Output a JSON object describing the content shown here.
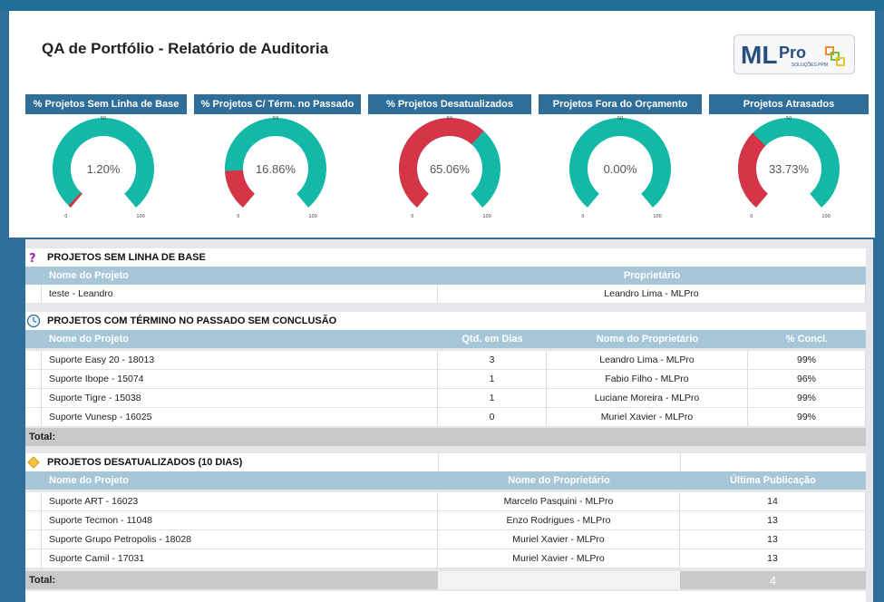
{
  "page": {
    "title": "QA de Portfólio - Relatório de Auditoria",
    "logo_text": "MLPro",
    "logo_sub": "SOLUÇÕES PPM"
  },
  "colors": {
    "teal": "#14b8a6",
    "red": "#d63447",
    "header_blue": "#2f6e99",
    "table_header": "#a7c6d8"
  },
  "cards": [
    {
      "title": "% Projetos Sem Linha de Base",
      "value_label": "1.20%",
      "value": 1.2
    },
    {
      "title": "% Projetos C/ Térm. no Passado",
      "value_label": "16.86%",
      "value": 16.86
    },
    {
      "title": "% Projetos Desatualizados",
      "value_label": "65.06%",
      "value": 65.06
    },
    {
      "title": "Projetos Fora do Orçamento",
      "value_label": "0.00%",
      "value": 0.0
    },
    {
      "title": "Projetos Atrasados",
      "value_label": "33.73%",
      "value": 33.73
    }
  ],
  "gauge_ticks": {
    "min": "0",
    "mid": "50",
    "max": "100"
  },
  "sections": {
    "baseline": {
      "icon": "question-icon",
      "title": "PROJETOS SEM LINHA DE BASE",
      "columns": [
        "Nome do Projeto",
        "Proprietário"
      ],
      "rows": [
        [
          "teste - Leandro",
          "Leandro Lima - MLPro"
        ]
      ]
    },
    "past": {
      "icon": "clock-icon",
      "title": "PROJETOS COM TÉRMINO NO PASSADO SEM CONCLUSÃO",
      "columns": [
        "Nome do Projeto",
        "Qtd. em Dias",
        "Nome do Proprietário",
        "% Concl."
      ],
      "rows": [
        [
          "Suporte Easy 20 - 18013",
          "3",
          "Leandro Lima - MLPro",
          "99%"
        ],
        [
          "Suporte Ibope - 15074",
          "1",
          "Fabio Filho - MLPro",
          "96%"
        ],
        [
          "Suporte Tigre - 15038",
          "1",
          "Luciane Moreira - MLPro",
          "99%"
        ],
        [
          "Suporte Vunesp - 16025",
          "0",
          "Muriel Xavier - MLPro",
          "99%"
        ]
      ],
      "total_label": "Total:"
    },
    "outdated": {
      "icon": "diamond-icon",
      "title": "PROJETOS DESATUALIZADOS (10 DIAS)",
      "columns": [
        "Nome do Projeto",
        "Nome do Proprietário",
        "Última Publicação"
      ],
      "rows": [
        [
          "Suporte ART - 16023",
          "Marcelo Pasquini - MLPro",
          "14"
        ],
        [
          "Suporte Tecmon - 11048",
          "Enzo Rodrigues - MLPro",
          "13"
        ],
        [
          "Suporte Grupo Petropolis - 18028",
          "Muriel Xavier - MLPro",
          "13"
        ],
        [
          "Suporte Camil - 17031",
          "Muriel Xavier - MLPro",
          "13"
        ]
      ],
      "total_label": "Total:",
      "total_value": "4"
    }
  }
}
